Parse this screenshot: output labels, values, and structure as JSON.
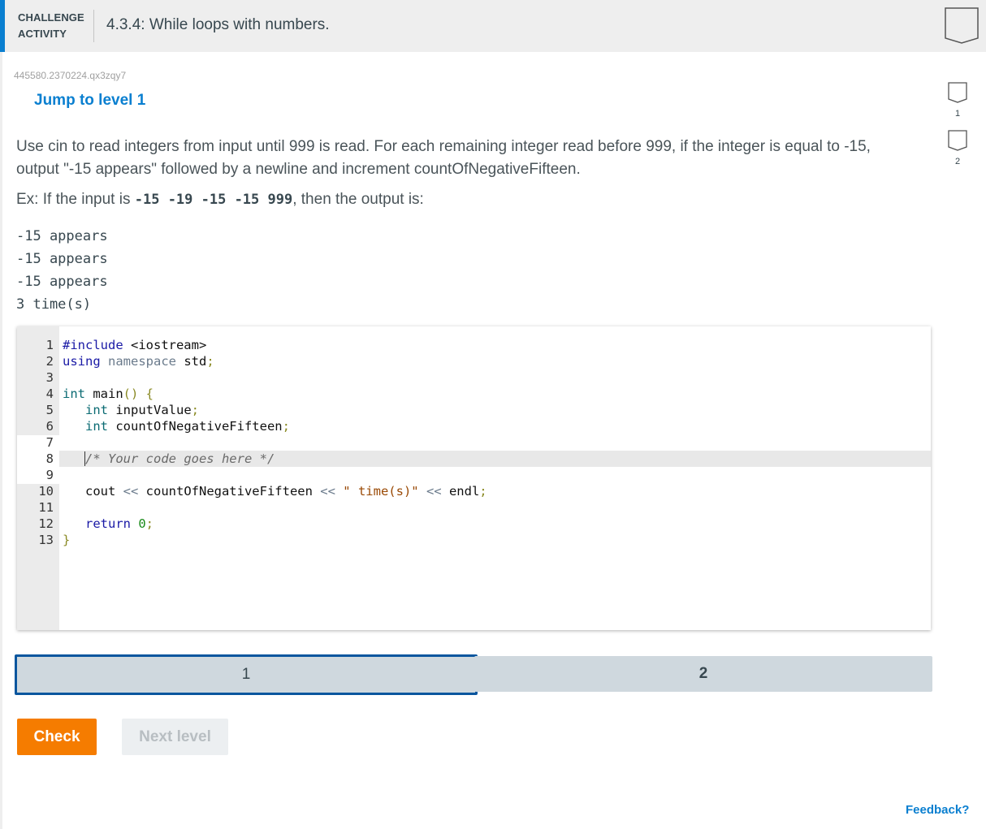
{
  "header": {
    "kind_line1": "CHALLENGE",
    "kind_line2": "ACTIVITY",
    "title": "4.3.4: While loops with numbers.",
    "accent_color": "#0a7fd0"
  },
  "activity_id": "445580.2370224.qx3zqy7",
  "jump_label": "Jump to level 1",
  "level_badges": [
    {
      "label": "1"
    },
    {
      "label": "2"
    }
  ],
  "prompt": {
    "text": "Use cin to read integers from input until 999 is read. For each remaining integer read before 999, if the integer is equal to -15, output \"-15 appears\" followed by a newline and increment countOfNegativeFifteen.",
    "example_prefix": "Ex: If the input is ",
    "example_input": "-15 -19 -15 -15 999",
    "example_suffix": ", then the output is:",
    "expected_output": [
      "-15 appears",
      "-15 appears",
      "-15 appears",
      "3 time(s)"
    ]
  },
  "editor": {
    "line_numbers": [
      "1",
      "2",
      "3",
      "4",
      "5",
      "6",
      "7",
      "8",
      "9",
      "10",
      "11",
      "12",
      "13"
    ],
    "lines": {
      "l1_directive": "#include",
      "l1_header": " <iostream>",
      "l2_using": "using",
      "l2_namespace": " namespace",
      "l2_std": " std",
      "l2_semi": ";",
      "l4_int": "int",
      "l4_main": " main",
      "l4_parens": "()",
      "l4_brace": " {",
      "l5_indent": "   ",
      "l5_int": "int",
      "l5_var": " inputValue",
      "l5_semi": ";",
      "l6_int": "int",
      "l6_var": " countOfNegativeFifteen",
      "l6_semi": ";",
      "l8_comment": "/* Your code goes here */",
      "l10_cout": "cout",
      "l10_op1": " <<",
      "l10_var": " countOfNegativeFifteen",
      "l10_op2": " <<",
      "l10_str": " \" time(s)\"",
      "l10_op3": " <<",
      "l10_endl": " endl",
      "l10_semi": ";",
      "l12_return": "return",
      "l12_zero": " 0",
      "l12_semi": ";",
      "l13_brace": "}"
    }
  },
  "levels": [
    {
      "label": "1",
      "active": true
    },
    {
      "label": "2",
      "active": false
    }
  ],
  "buttons": {
    "check": "Check",
    "next_level": "Next level"
  },
  "feedback_link": "Feedback?"
}
